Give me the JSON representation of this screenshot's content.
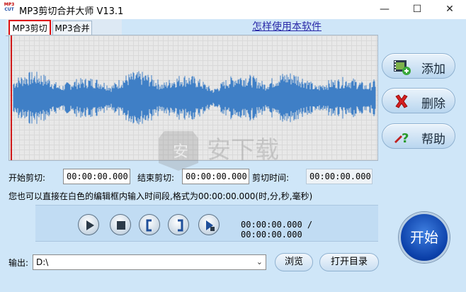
{
  "window": {
    "title": "MP3剪切合并大师 V13.1",
    "icon_top": "MP3",
    "icon_bottom": "CUT",
    "minimize_glyph": "—",
    "maximize_glyph": "☐",
    "close_glyph": "✕"
  },
  "tabs": [
    {
      "label": "MP3剪切",
      "active": true
    },
    {
      "label": "MP3合并",
      "active": false
    }
  ],
  "help_link": "怎样使用本软件",
  "side_buttons": {
    "add": "添加",
    "delete": "删除",
    "help": "帮助"
  },
  "times": {
    "start_label": "开始剪切:",
    "start_value": "00:00:00.000",
    "end_label": "结束剪切:",
    "end_value": "00:00:00.000",
    "duration_label": "剪切时间:",
    "duration_value": "00:00:00.000"
  },
  "hint": "您也可以直接在白色的编辑框内输入时间段,格式为00:00:00.000(时,分,秒,毫秒)",
  "playback": {
    "position": "00:00:00.000 / 00:00:00.000",
    "controls": [
      "play-icon",
      "stop-icon",
      "mark-start-icon",
      "mark-end-icon",
      "play-selection-icon"
    ]
  },
  "start_button": "开始",
  "output": {
    "label": "输出:",
    "value": "D:\\",
    "browse": "浏览",
    "open_dir": "打开目录"
  },
  "watermark_text": "安下载",
  "colors": {
    "waveform": "#3f7fc6",
    "playhead": "#d01818",
    "tab_highlight": "#e01010",
    "start_button": "#0b3fa8"
  }
}
